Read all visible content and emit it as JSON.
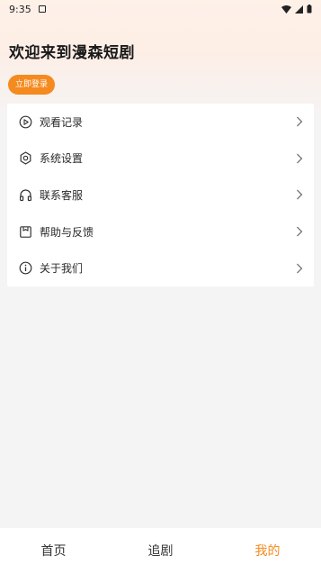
{
  "status_bar": {
    "time": "9:35"
  },
  "header": {
    "welcome_text": "欢迎来到漫森短剧",
    "login_button_label": "立即登录"
  },
  "menu": {
    "items": [
      {
        "label": "观看记录",
        "icon": "play-circle-icon"
      },
      {
        "label": "系统设置",
        "icon": "gear-icon"
      },
      {
        "label": "联系客服",
        "icon": "headphones-icon"
      },
      {
        "label": "帮助与反馈",
        "icon": "feedback-icon"
      },
      {
        "label": "关于我们",
        "icon": "info-icon"
      }
    ]
  },
  "tabbar": {
    "tabs": [
      {
        "label": "首页"
      },
      {
        "label": "追剧"
      },
      {
        "label": "我的"
      }
    ],
    "active_index": 2
  },
  "colors": {
    "accent": "#f58a1f",
    "text": "#2a2a2a",
    "background": "#f5f4f4"
  }
}
